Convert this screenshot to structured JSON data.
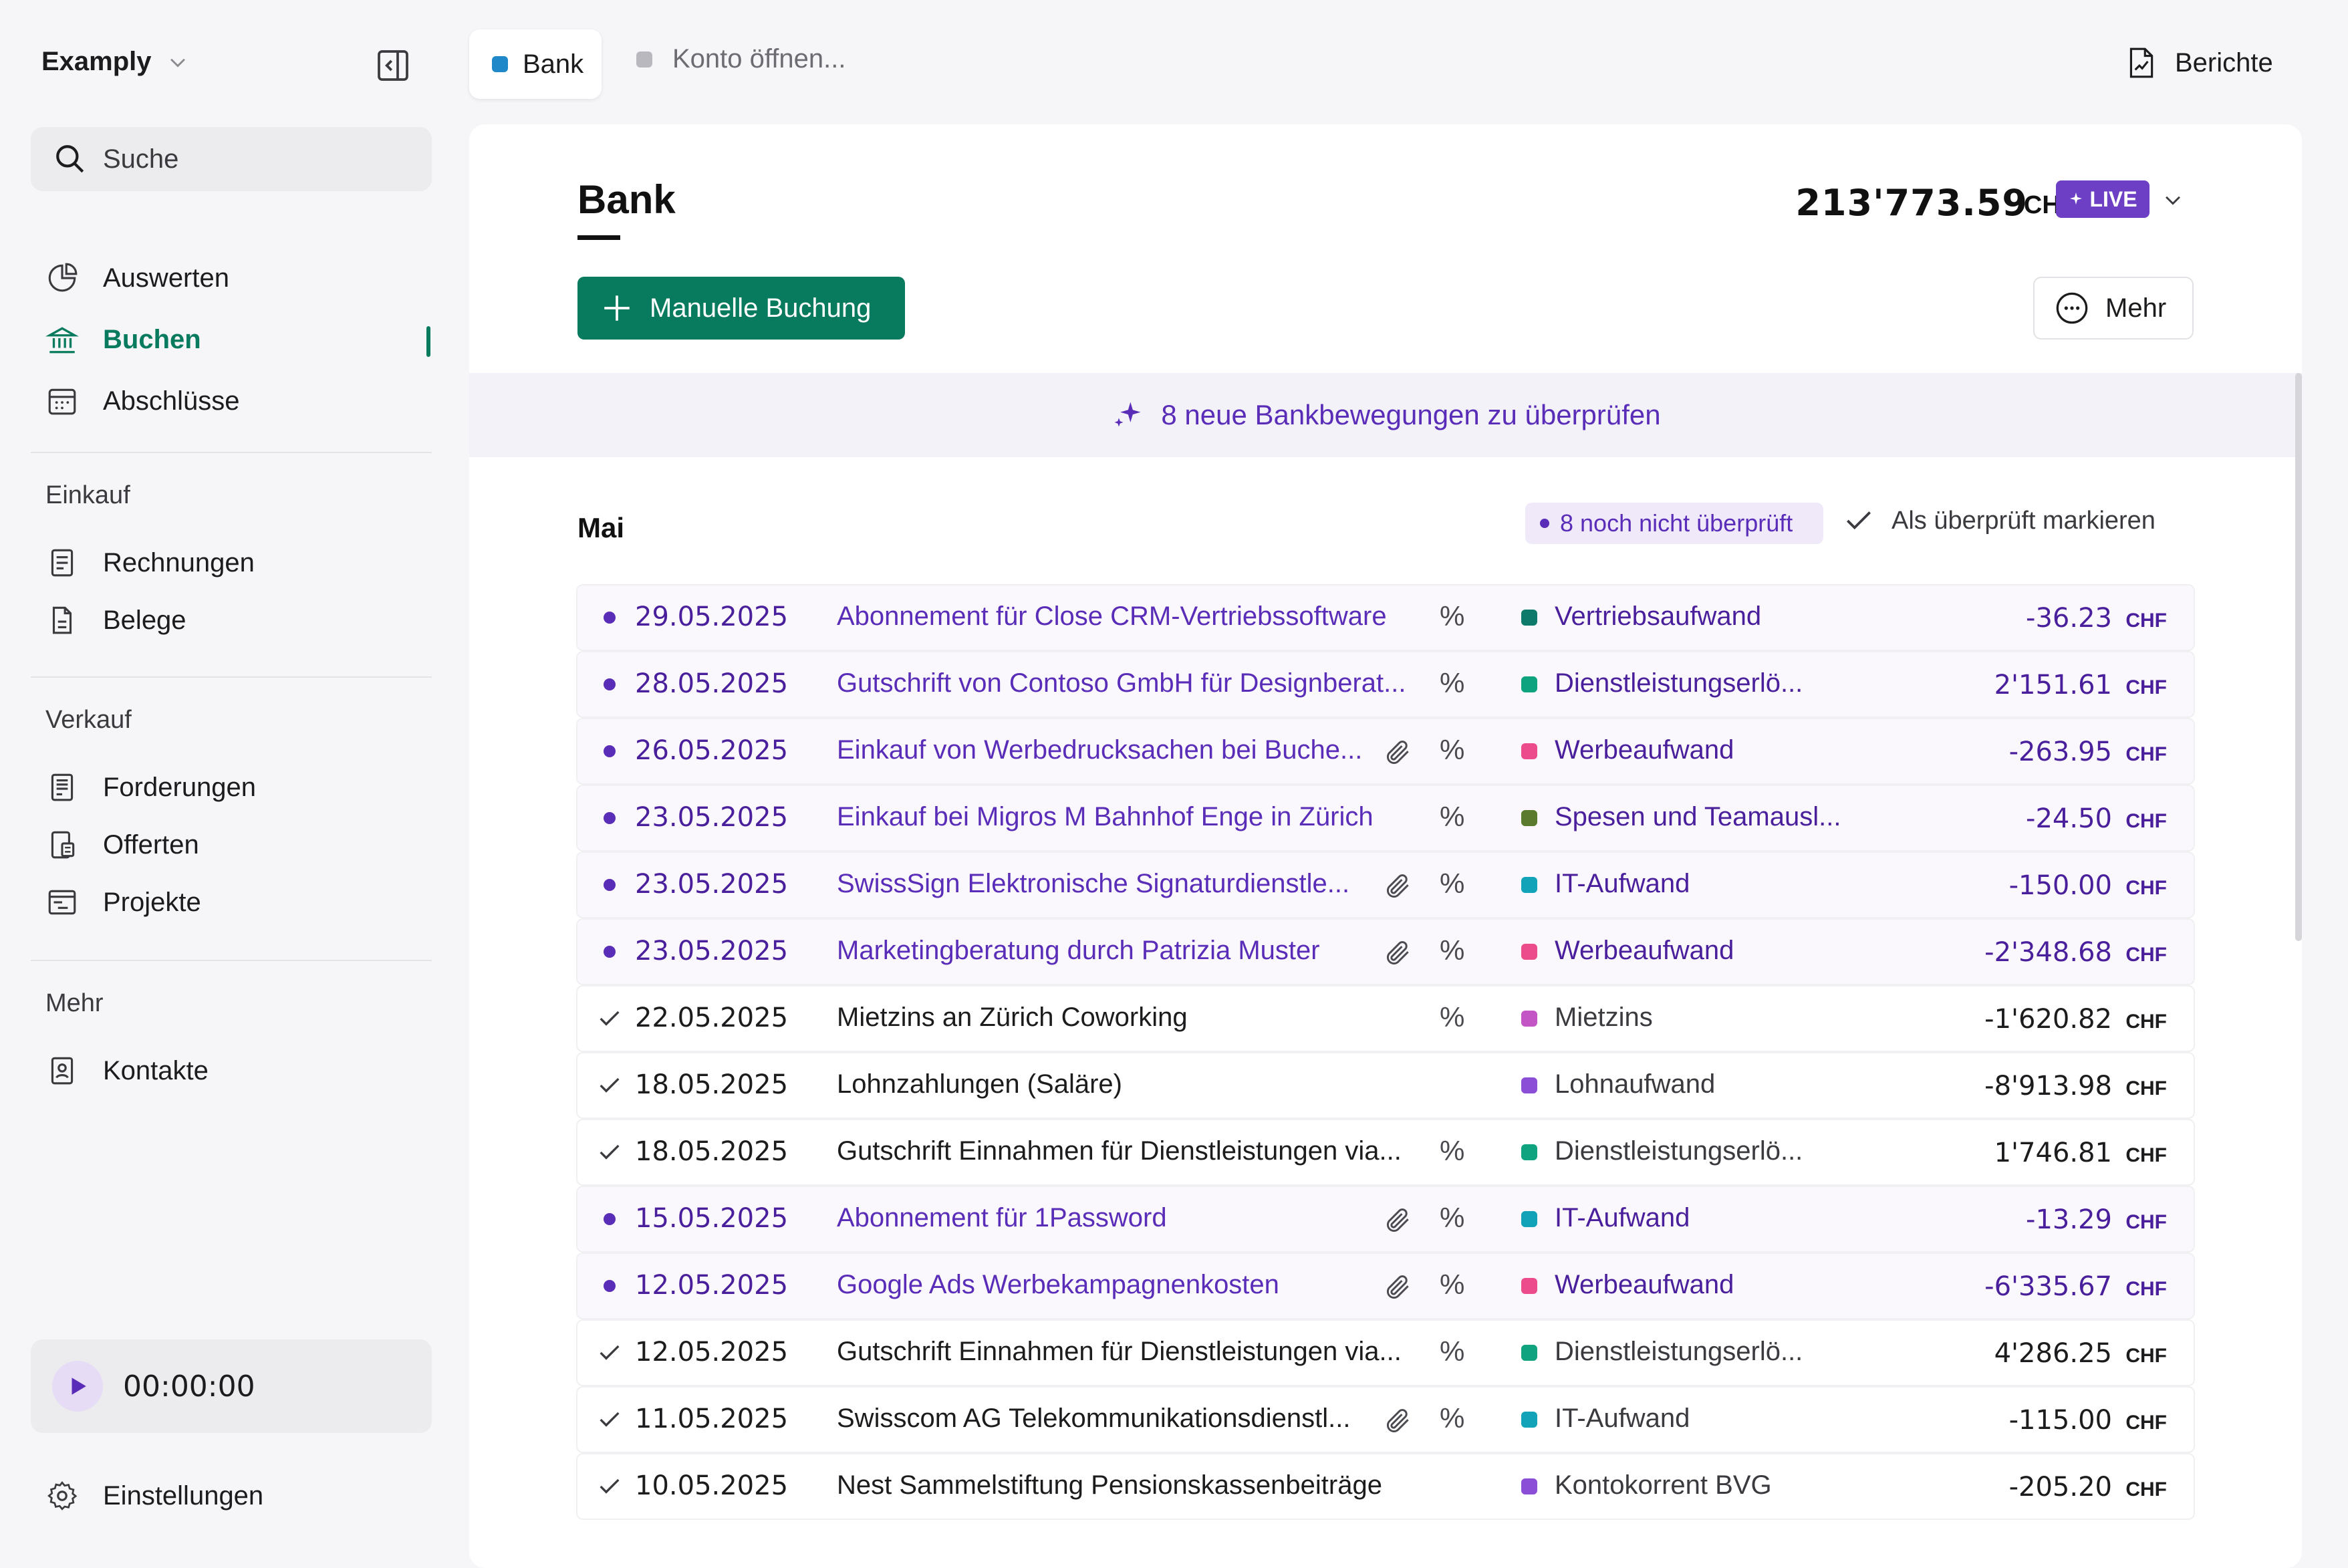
{
  "sidebar": {
    "company": "Examply",
    "search_placeholder": "Suche",
    "nav_main": [
      {
        "label": "Auswerten",
        "icon": "chart-pie-icon"
      },
      {
        "label": "Buchen",
        "icon": "bank-icon",
        "active": true
      },
      {
        "label": "Abschlüsse",
        "icon": "calendar-icon"
      }
    ],
    "sections": [
      {
        "label": "Einkauf",
        "items": [
          {
            "label": "Rechnungen",
            "icon": "invoice-icon"
          },
          {
            "label": "Belege",
            "icon": "document-icon"
          }
        ]
      },
      {
        "label": "Verkauf",
        "items": [
          {
            "label": "Forderungen",
            "icon": "receivables-icon"
          },
          {
            "label": "Offerten",
            "icon": "offer-icon"
          },
          {
            "label": "Projekte",
            "icon": "project-icon"
          }
        ]
      },
      {
        "label": "Mehr",
        "items": [
          {
            "label": "Kontakte",
            "icon": "contact-icon"
          }
        ]
      }
    ],
    "timer": "00:00:00",
    "settings": "Einstellungen"
  },
  "topbar": {
    "tab_bank": "Bank",
    "tab_open": "Konto öffnen...",
    "reports": "Berichte"
  },
  "header": {
    "title": "Bank",
    "balance": "213'773.59",
    "currency": "CHF",
    "live": "LIVE",
    "manual_button": "Manuelle Buchung",
    "more_button": "Mehr"
  },
  "banner": {
    "text": "8 neue Bankbewegungen zu überprüfen"
  },
  "month": {
    "label": "Mai",
    "unreviewed": "8 noch nicht überprüft",
    "mark_reviewed": "Als überprüft markieren"
  },
  "colors": {
    "accent_green": "#087a5e",
    "accent_purple": "#5a2db8",
    "live_badge": "#6c3fc4"
  },
  "transactions": [
    {
      "reviewed": false,
      "date": "29.05.2025",
      "description": "Abonnement für Close CRM-Vertriebssoftware",
      "attachment": false,
      "vat": true,
      "category": "Vertriebsaufwand",
      "category_color": "#0d7a6c",
      "amount": "-36.23",
      "currency": "CHF"
    },
    {
      "reviewed": false,
      "date": "28.05.2025",
      "description": "Gutschrift von Contoso GmbH für Designberat...",
      "attachment": false,
      "vat": true,
      "category": "Dienstleistungserlö...",
      "category_color": "#10a37f",
      "amount": "2'151.61",
      "currency": "CHF"
    },
    {
      "reviewed": false,
      "date": "26.05.2025",
      "description": "Einkauf von Werbedrucksachen bei Buche...",
      "attachment": true,
      "vat": true,
      "category": "Werbeaufwand",
      "category_color": "#ec4c8c",
      "amount": "-263.95",
      "currency": "CHF"
    },
    {
      "reviewed": false,
      "date": "23.05.2025",
      "description": "Einkauf bei Migros M Bahnhof Enge in Zürich",
      "attachment": false,
      "vat": true,
      "category": "Spesen und Teamausl...",
      "category_color": "#5c7a2e",
      "amount": "-24.50",
      "currency": "CHF"
    },
    {
      "reviewed": false,
      "date": "23.05.2025",
      "description": "SwissSign Elektronische Signaturdienstle...",
      "attachment": true,
      "vat": true,
      "category": "IT-Aufwand",
      "category_color": "#12a3b8",
      "amount": "-150.00",
      "currency": "CHF"
    },
    {
      "reviewed": false,
      "date": "23.05.2025",
      "description": "Marketingberatung durch Patrizia Muster",
      "attachment": true,
      "vat": true,
      "category": "Werbeaufwand",
      "category_color": "#ec4c8c",
      "amount": "-2'348.68",
      "currency": "CHF"
    },
    {
      "reviewed": true,
      "date": "22.05.2025",
      "description": "Mietzins an Zürich Coworking",
      "attachment": false,
      "vat": true,
      "category": "Mietzins",
      "category_color": "#c455c4",
      "amount": "-1'620.82",
      "currency": "CHF"
    },
    {
      "reviewed": true,
      "date": "18.05.2025",
      "description": "Lohnzahlungen (Saläre)",
      "attachment": false,
      "vat": false,
      "category": "Lohnaufwand",
      "category_color": "#8a4fd6",
      "amount": "-8'913.98",
      "currency": "CHF"
    },
    {
      "reviewed": true,
      "date": "18.05.2025",
      "description": "Gutschrift Einnahmen für Dienstleistungen via...",
      "attachment": false,
      "vat": true,
      "category": "Dienstleistungserlö...",
      "category_color": "#10a37f",
      "amount": "1'746.81",
      "currency": "CHF"
    },
    {
      "reviewed": false,
      "date": "15.05.2025",
      "description": "Abonnement für 1Password",
      "attachment": true,
      "vat": true,
      "category": "IT-Aufwand",
      "category_color": "#12a3b8",
      "amount": "-13.29",
      "currency": "CHF"
    },
    {
      "reviewed": false,
      "date": "12.05.2025",
      "description": "Google Ads Werbekampagnenkosten",
      "attachment": true,
      "vat": true,
      "category": "Werbeaufwand",
      "category_color": "#ec4c8c",
      "amount": "-6'335.67",
      "currency": "CHF"
    },
    {
      "reviewed": true,
      "date": "12.05.2025",
      "description": "Gutschrift Einnahmen für Dienstleistungen via...",
      "attachment": false,
      "vat": true,
      "category": "Dienstleistungserlö...",
      "category_color": "#10a37f",
      "amount": "4'286.25",
      "currency": "CHF"
    },
    {
      "reviewed": true,
      "date": "11.05.2025",
      "description": "Swisscom AG Telekommunikationsdienstl...",
      "attachment": true,
      "vat": true,
      "category": "IT-Aufwand",
      "category_color": "#12a3b8",
      "amount": "-115.00",
      "currency": "CHF"
    },
    {
      "reviewed": true,
      "date": "10.05.2025",
      "description": "Nest Sammelstiftung Pensionskassenbeiträge",
      "attachment": false,
      "vat": false,
      "category": "Kontokorrent BVG",
      "category_color": "#8a4fd6",
      "amount": "-205.20",
      "currency": "CHF"
    }
  ]
}
